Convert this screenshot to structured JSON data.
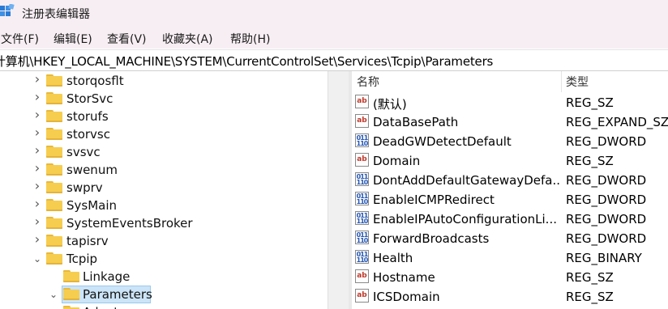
{
  "window": {
    "title": "注册表编辑器",
    "icon": "registry-icon"
  },
  "menu": [
    "文件(F)",
    "编辑(E)",
    "查看(V)",
    "收藏夹(A)",
    "帮助(H)"
  ],
  "address": "计算机\\HKEY_LOCAL_MACHINE\\SYSTEM\\CurrentControlSet\\Services\\Tcpip\\Parameters",
  "tree": [
    {
      "label": "storqosflt",
      "expander": "collapsed"
    },
    {
      "label": "StorSvc",
      "expander": "collapsed"
    },
    {
      "label": "storufs",
      "expander": "collapsed"
    },
    {
      "label": "storvsc",
      "expander": "collapsed"
    },
    {
      "label": "svsvc",
      "expander": "collapsed"
    },
    {
      "label": "swenum",
      "expander": "collapsed"
    },
    {
      "label": "swprv",
      "expander": "collapsed"
    },
    {
      "label": "SysMain",
      "expander": "collapsed"
    },
    {
      "label": "SystemEventsBroker",
      "expander": "collapsed"
    },
    {
      "label": "tapisrv",
      "expander": "collapsed"
    },
    {
      "label": "Tcpip",
      "expander": "expanded"
    },
    {
      "label": "Linkage",
      "expander": "none"
    },
    {
      "label": "Parameters",
      "expander": "expanded",
      "selected": true
    },
    {
      "label": "Adapters",
      "expander": "none"
    }
  ],
  "columns": {
    "name": "名称",
    "type": "类型"
  },
  "values": [
    {
      "name": "(默认)",
      "type": "REG_SZ",
      "icon": "string-value-icon"
    },
    {
      "name": "DataBasePath",
      "type": "REG_EXPAND_SZ",
      "icon": "string-value-icon"
    },
    {
      "name": "DeadGWDetectDefault",
      "type": "REG_DWORD",
      "icon": "binary-value-icon"
    },
    {
      "name": "Domain",
      "type": "REG_SZ",
      "icon": "string-value-icon"
    },
    {
      "name": "DontAddDefaultGatewayDefa...",
      "type": "REG_DWORD",
      "icon": "binary-value-icon"
    },
    {
      "name": "EnableICMPRedirect",
      "type": "REG_DWORD",
      "icon": "binary-value-icon"
    },
    {
      "name": "EnableIPAutoConfigurationLi...",
      "type": "REG_DWORD",
      "icon": "binary-value-icon"
    },
    {
      "name": "ForwardBroadcasts",
      "type": "REG_DWORD",
      "icon": "binary-value-icon"
    },
    {
      "name": "Health",
      "type": "REG_BINARY",
      "icon": "binary-value-icon"
    },
    {
      "name": "Hostname",
      "type": "REG_SZ",
      "icon": "string-value-icon"
    },
    {
      "name": "ICSDomain",
      "type": "REG_SZ",
      "icon": "string-value-icon"
    }
  ],
  "icons": {
    "string": "ab",
    "binary": "011\n110"
  }
}
